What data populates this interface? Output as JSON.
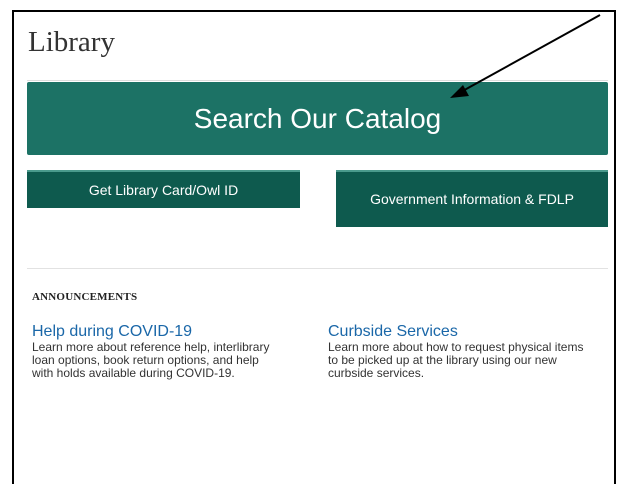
{
  "page": {
    "title": "Library"
  },
  "buttons": {
    "catalog_label": "Search Our Catalog",
    "library_card_label": "Get Library Card/Owl ID",
    "gov_info_label": "Government Information & FDLP"
  },
  "announcements": {
    "heading": "ANNOUNCEMENTS",
    "items": [
      {
        "title": "Help during COVID-19",
        "description": "Learn more about reference help, interlibrary loan options, book return options, and help with holds available during COVID-19."
      },
      {
        "title": "Curbside Services",
        "description": "Learn more about how to request physical items to be picked up at the library using our new curbside services."
      }
    ]
  },
  "colors": {
    "primary_button": "#1c7265",
    "secondary_button": "#0e5a4e",
    "link": "#1a67a8",
    "annotation_arrow": "#000000"
  }
}
